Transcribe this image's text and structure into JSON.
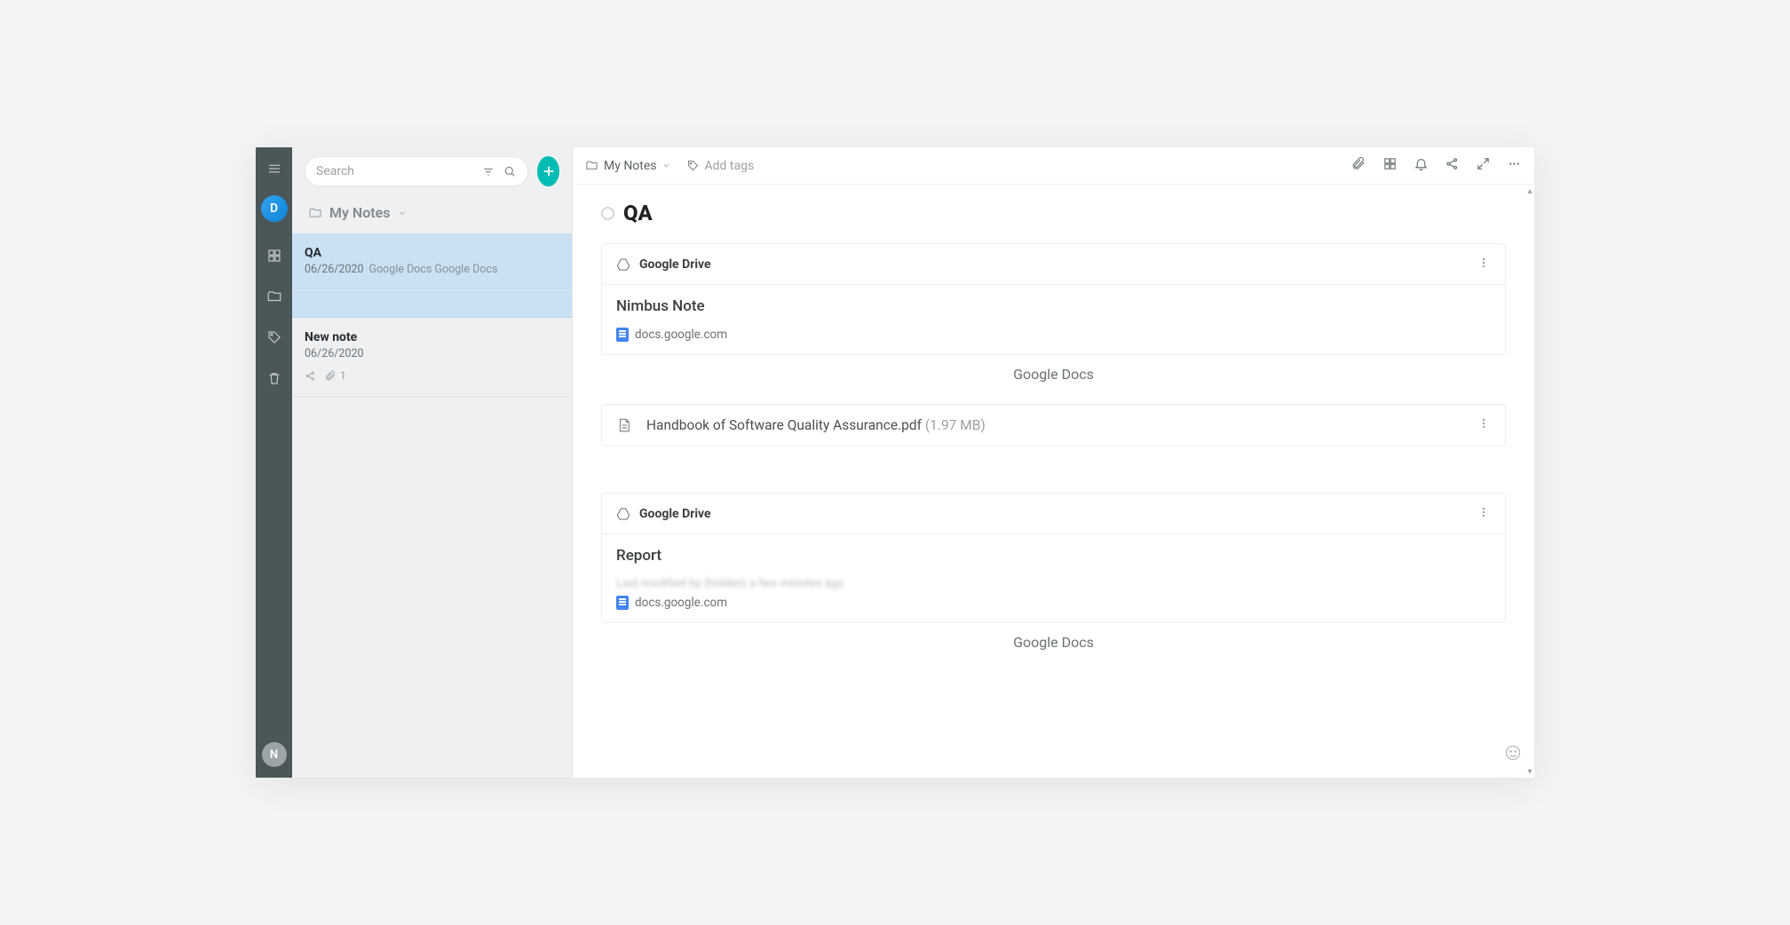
{
  "rail": {
    "avatar_top": "D",
    "avatar_bottom": "N"
  },
  "sidebar": {
    "search_placeholder": "Search",
    "folder_label": "My Notes",
    "notes": [
      {
        "title": "QA",
        "date": "06/26/2020",
        "snippet": "Google Docs Google Docs"
      },
      {
        "title": "New note",
        "date": "06/26/2020",
        "attachments": "1"
      }
    ]
  },
  "topbar": {
    "breadcrumb": "My Notes",
    "tags_placeholder": "Add tags"
  },
  "doc": {
    "title": "QA",
    "cards": [
      {
        "source": "Google Drive",
        "title": "Nimbus Note",
        "link_text": "docs.google.com",
        "caption": "Google Docs"
      },
      {
        "type": "file",
        "file_name": "Handbook of Software Quality Assurance.pdf",
        "file_size": "(1.97 MB)"
      },
      {
        "source": "Google Drive",
        "title": "Report",
        "modified_blur": "Last modified by (hidden) a few minutes ago",
        "link_text": "docs.google.com",
        "caption": "Google Docs"
      }
    ]
  }
}
